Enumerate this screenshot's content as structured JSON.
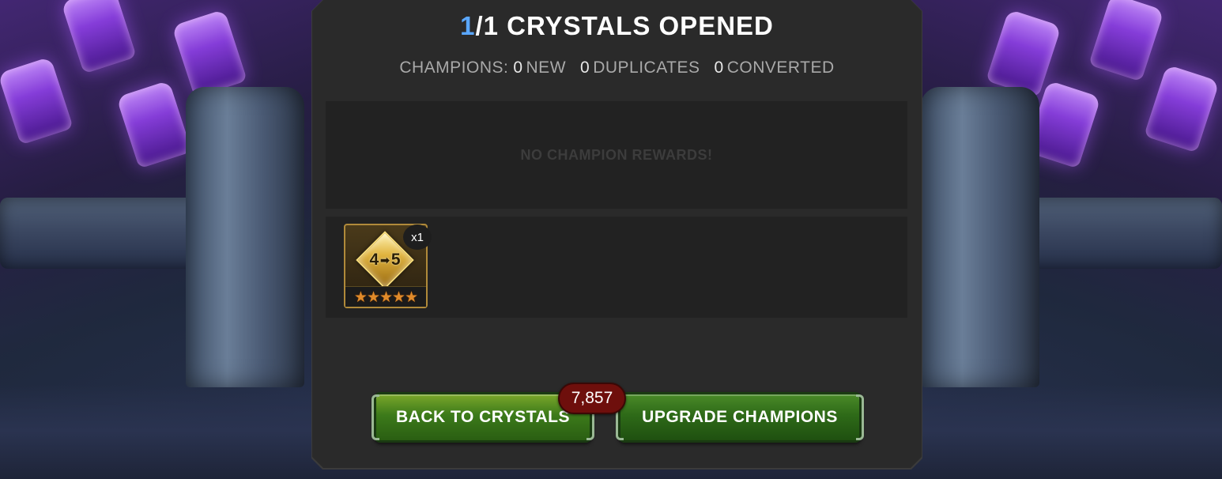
{
  "header": {
    "opened_count": "1",
    "opened_rest": "/1 CRYSTALS OPENED"
  },
  "summary": {
    "prefix": "CHAMPIONS:",
    "new_count": "0",
    "new_label": "NEW",
    "duplicates_count": "0",
    "duplicates_label": "DUPLICATES",
    "converted_count": "0",
    "converted_label": "CONVERTED"
  },
  "champion_rewards": {
    "empty_message": "NO CHAMPION REWARDS!"
  },
  "items": [
    {
      "icon": "rank-up-gem-icon",
      "from_rank": "4",
      "to_rank": "5",
      "stars": "★★★★★",
      "quantity": "x1"
    }
  ],
  "buttons": {
    "back_label": "BACK TO CRYSTALS",
    "upgrade_label": "UPGRADE CHAMPIONS",
    "price": "7,857"
  },
  "colors": {
    "accent_blue": "#5aa7ff",
    "button_green": "#3c7a1a",
    "price_red": "#6e0f0c",
    "star_orange": "#e08a2a"
  }
}
